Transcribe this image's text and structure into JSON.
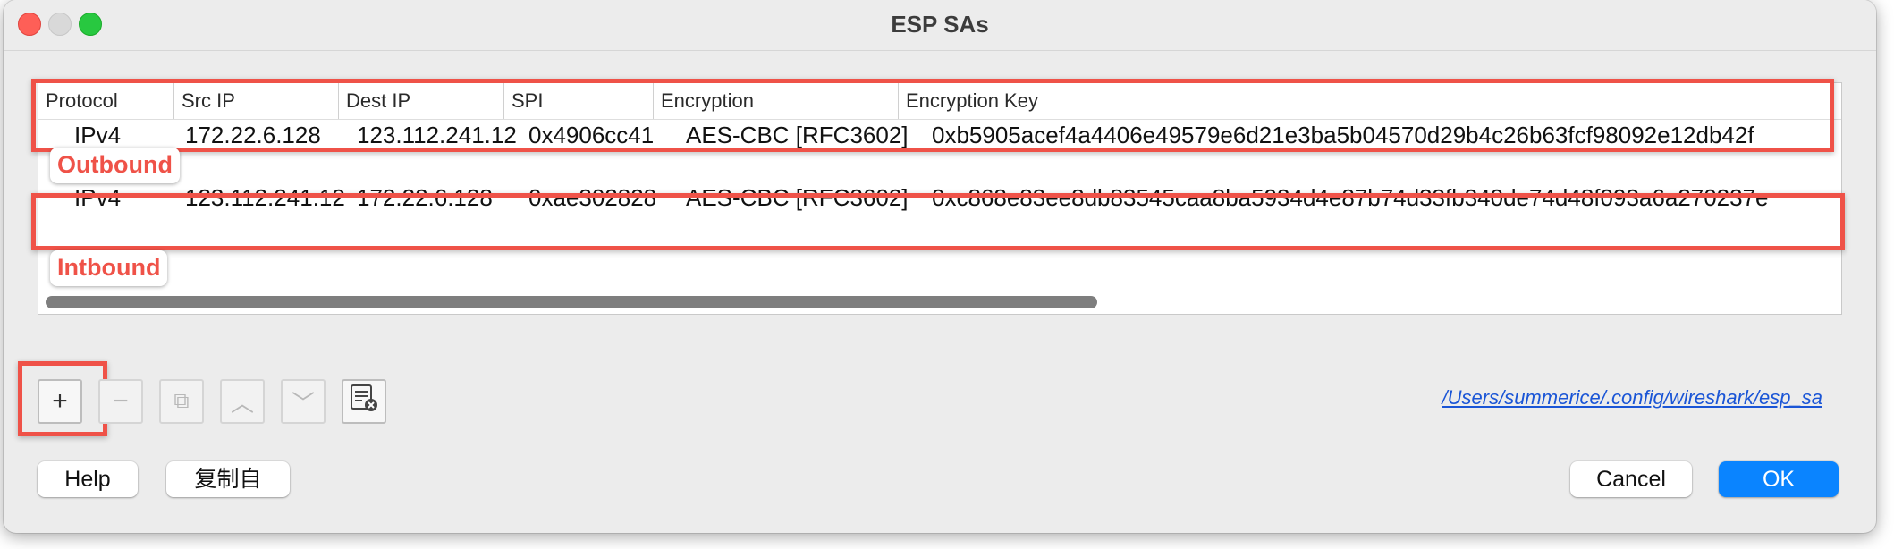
{
  "window": {
    "title": "ESP SAs"
  },
  "table": {
    "columns": [
      "Protocol",
      "Src IP",
      "Dest IP",
      "SPI",
      "Encryption",
      "Encryption Key"
    ],
    "rows": [
      [
        "IPv4",
        "172.22.6.128",
        "123.112.241.12",
        "0x4906cc41",
        "AES-CBC [RFC3602]",
        "0xb5905acef4a4406e49579e6d21e3ba5b04570d29b4c26b63fcf98092e12db42f"
      ],
      [
        "IPv4",
        "123.112.241.12",
        "172.22.6.128",
        "0xae302828",
        "AES-CBC [RFC3602]",
        "0xc868e83ee8db83545caa8ba5934d4e87b74d33fb340de74d48f093a6a270237e"
      ]
    ]
  },
  "annotations": {
    "outbound": "Outbound",
    "inbound": "Intbound"
  },
  "toolbar": {
    "add": "+",
    "remove": "−",
    "copy": "⧉",
    "up": "︿",
    "down": "﹀"
  },
  "path_link": "/Users/summerice/.config/wireshark/esp_sa",
  "buttons": {
    "help": "Help",
    "copy_from": "复制自",
    "cancel": "Cancel",
    "ok": "OK"
  },
  "colors": {
    "highlight": "#ef5248",
    "ok_button": "#0a84ff",
    "link": "#1a55d6"
  }
}
